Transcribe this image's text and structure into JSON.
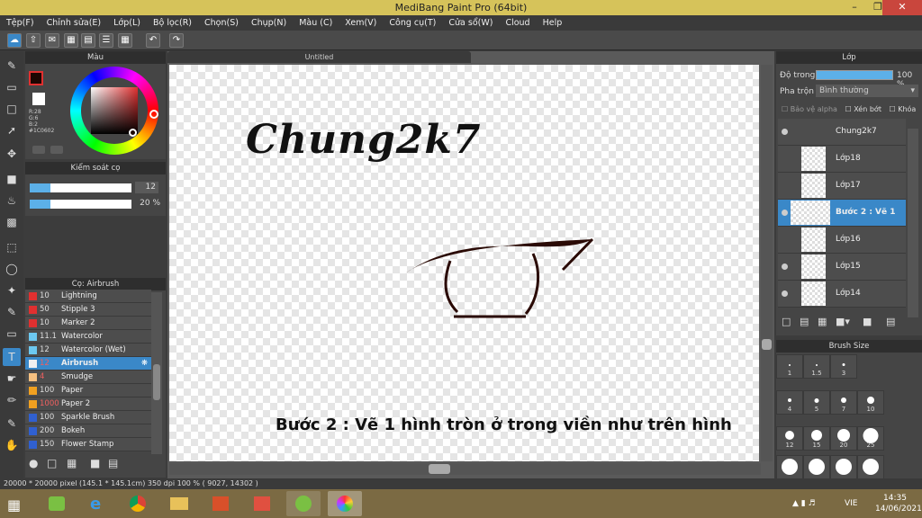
{
  "window": {
    "title": "MediBang Paint Pro (64bit)"
  },
  "menu": [
    "Tệp(F)",
    "Chỉnh sửa(E)",
    "Lớp(L)",
    "Bộ lọc(R)",
    "Chọn(S)",
    "Chụp(N)",
    "Màu (C)",
    "Xem(V)",
    "Công cụ(T)",
    "Cửa sổ(W)",
    "Cloud",
    "Help"
  ],
  "color_panel": {
    "title": "Màu",
    "r": "R:28",
    "g": "G:6",
    "b": "B:2",
    "hex": "#1C0602",
    "fg": "#1C0602",
    "bg": "#ffffff"
  },
  "brush_control": {
    "title": "Kiểm soát cọ",
    "size": "12",
    "opacity": "20 %",
    "size_fraction": 0.2,
    "opacity_fraction": 0.2
  },
  "brush_list": {
    "title": "Cọ: Airbrush",
    "items": [
      {
        "size": "10",
        "name": "Lightning",
        "color": "#e03030"
      },
      {
        "size": "50",
        "name": "Stipple 3",
        "color": "#e03030"
      },
      {
        "size": "10",
        "name": "Marker 2",
        "color": "#e03030"
      },
      {
        "size": "11.1",
        "name": "Watercolor",
        "color": "#6cc8f0"
      },
      {
        "size": "12",
        "name": "Watercolor (Wet)",
        "color": "#6cc8f0"
      },
      {
        "size": "12",
        "name": "Airbrush",
        "color": "#f0f0f0",
        "active": true
      },
      {
        "size": "4",
        "name": "Smudge",
        "color": "#f5c080"
      },
      {
        "size": "100",
        "name": "Paper",
        "color": "#f0a020"
      },
      {
        "size": "1000",
        "name": "Paper 2",
        "color": "#f0a020"
      },
      {
        "size": "100",
        "name": "Sparkle Brush",
        "color": "#3060d0"
      },
      {
        "size": "200",
        "name": "Bokeh",
        "color": "#3060d0"
      },
      {
        "size": "150",
        "name": "Flower Stamp",
        "color": "#3060d0"
      }
    ]
  },
  "canvas": {
    "tab": "Untitled",
    "title_text": "Chung2k7",
    "caption": "Bước 2 : Vẽ 1 hình tròn ở trong viền như trên hình",
    "stroke_color": "#2a0a05"
  },
  "layer_panel": {
    "title": "Lớp",
    "opacity_label": "Độ trong",
    "opacity_value": "100 %",
    "blend_label": "Pha trộn",
    "blend_value": "Bình thường",
    "protect_alpha": "Bảo vệ alpha",
    "clip": "Xén bớt",
    "lock": "Khóa",
    "layers": [
      {
        "name": "Chung2k7",
        "visible": true
      },
      {
        "name": "Lớp18",
        "visible": false
      },
      {
        "name": "Lớp17",
        "visible": false
      },
      {
        "name": "Bước 2 : Vẽ 1",
        "visible": true,
        "active": true
      },
      {
        "name": "Lớp16",
        "visible": false
      },
      {
        "name": "Lớp15",
        "visible": true
      },
      {
        "name": "Lớp14",
        "visible": true
      }
    ]
  },
  "brush_size": {
    "title": "Brush Size",
    "sizes": [
      "1",
      "1.5",
      "3",
      "4",
      "5",
      "7",
      "10",
      "12",
      "15",
      "20",
      "25"
    ]
  },
  "status": {
    "text": "20000 * 20000 pixel   (145.1 * 145.1cm)   350 dpi   100 %   ( 9027, 14302 )"
  },
  "taskbar": {
    "lang": "VIE",
    "time": "14:35",
    "date": "14/06/2021"
  }
}
